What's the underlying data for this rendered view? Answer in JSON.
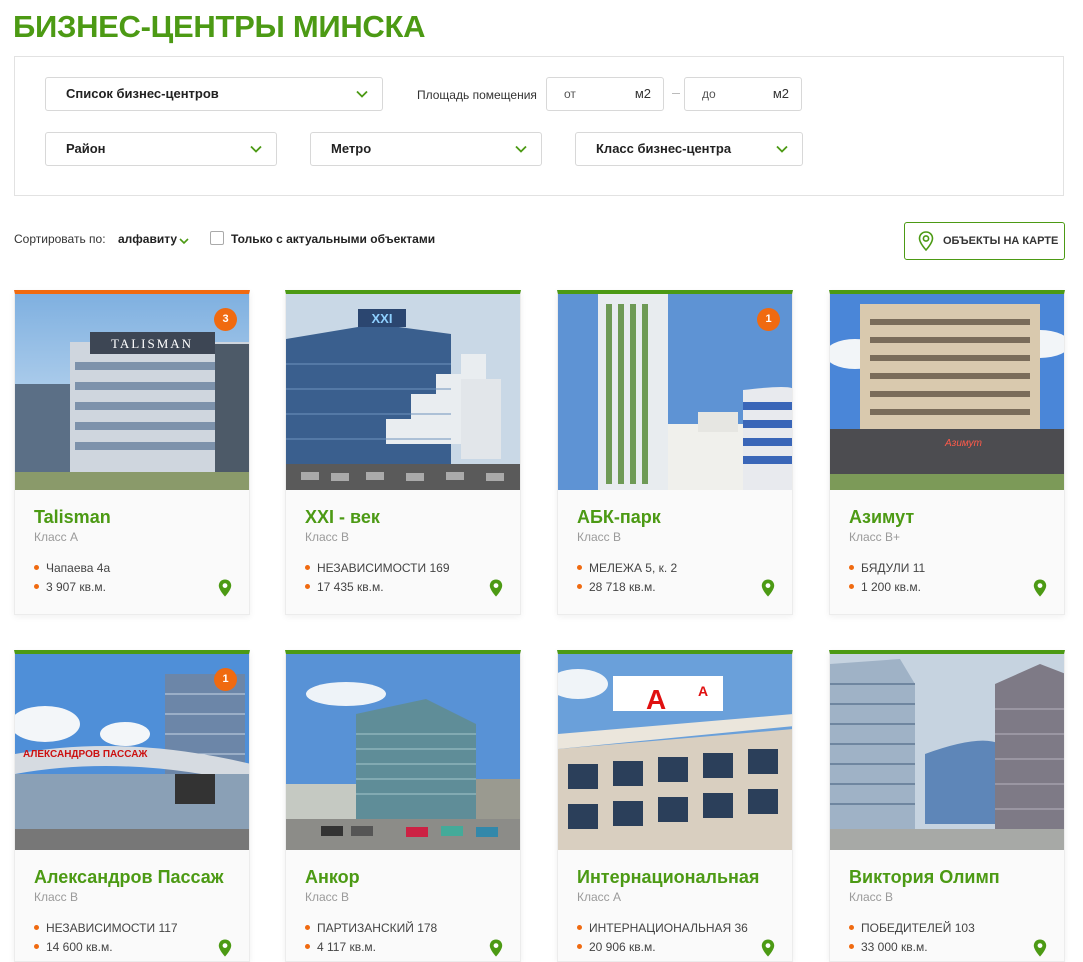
{
  "page": {
    "title": "БИЗНЕС-ЦЕНТРЫ МИНСКА"
  },
  "filters": {
    "list_select": "Список бизнес-центров",
    "area_label": "Площадь помещения",
    "area_from_placeholder": "от",
    "area_to_placeholder": "до",
    "area_unit": "м2",
    "district_select": "Район",
    "metro_select": "Метро",
    "class_select": "Класс бизнес-центра"
  },
  "sort": {
    "label": "Сортировать по:",
    "value": "алфавиту",
    "only_actual_label": "Только с актуальными объектами",
    "only_actual_checked": false
  },
  "map_button": {
    "label": "ОБЪЕКТЫ НА КАРТЕ",
    "icon": "map-pin-icon"
  },
  "colors": {
    "accent": "#4c9a14",
    "highlight": "#f06a10"
  },
  "cards": [
    {
      "name": "Talisman",
      "class": "Класс А",
      "address": "Чапаева 4а",
      "size": "3 907 кв.м.",
      "badge": "3",
      "highlight": true
    },
    {
      "name": "XXI - век",
      "class": "Класс В",
      "address": "НЕЗАВИСИМОСТИ 169",
      "size": "17 435 кв.м.",
      "badge": "",
      "highlight": false
    },
    {
      "name": "АБК-парк",
      "class": "Класс В",
      "address": "МЕЛЕЖА 5, к. 2",
      "size": "28 718 кв.м.",
      "badge": "1",
      "highlight": false
    },
    {
      "name": "Азимут",
      "class": "Класс В+",
      "address": "БЯДУЛИ 11",
      "size": "1 200 кв.м.",
      "badge": "",
      "highlight": false
    },
    {
      "name": "Александров Пассаж",
      "class": "Класс В",
      "address": "НЕЗАВИСИМОСТИ 117",
      "size": "14 600 кв.м.",
      "badge": "1",
      "highlight": false
    },
    {
      "name": "Анкор",
      "class": "Класс В",
      "address": "ПАРТИЗАНСКИЙ 178",
      "size": "4 117 кв.м.",
      "badge": "",
      "highlight": false
    },
    {
      "name": "Интернациональная",
      "class": "Класс А",
      "address": "ИНТЕРНАЦИОНАЛЬНАЯ 36",
      "size": "20 906 кв.м.",
      "badge": "",
      "highlight": false
    },
    {
      "name": "Виктория Олимп",
      "class": "Класс В",
      "address": "ПОБЕДИТЕЛЕЙ 103",
      "size": "33 000 кв.м.",
      "badge": "",
      "highlight": false
    }
  ]
}
